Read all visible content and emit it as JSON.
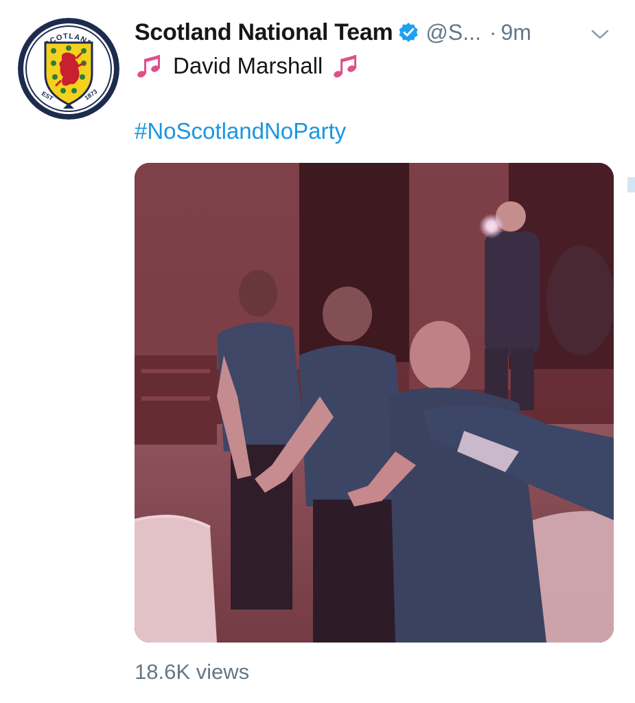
{
  "tweet": {
    "author": {
      "display_name": "Scotland National Team",
      "handle": "@S...",
      "verified": true,
      "avatar_badge_top_text": "SCOTLAND",
      "avatar_badge_left_text": "EST",
      "avatar_badge_right_text": "1873"
    },
    "separator": "·",
    "timestamp": "9m",
    "body_text": "David Marshall",
    "hashtag": "#NoScotlandNoParty",
    "media": {
      "kind": "video"
    },
    "views": "18.6K views"
  },
  "icons": {
    "verified": "verified-badge-icon",
    "music_note": "music-notes-icon",
    "more": "chevron-down-icon"
  },
  "colors": {
    "text_primary": "#14171a",
    "text_secondary": "#657786",
    "link": "#1b95e0",
    "verified": "#1da1f2",
    "note_pink": "#e0508a"
  }
}
